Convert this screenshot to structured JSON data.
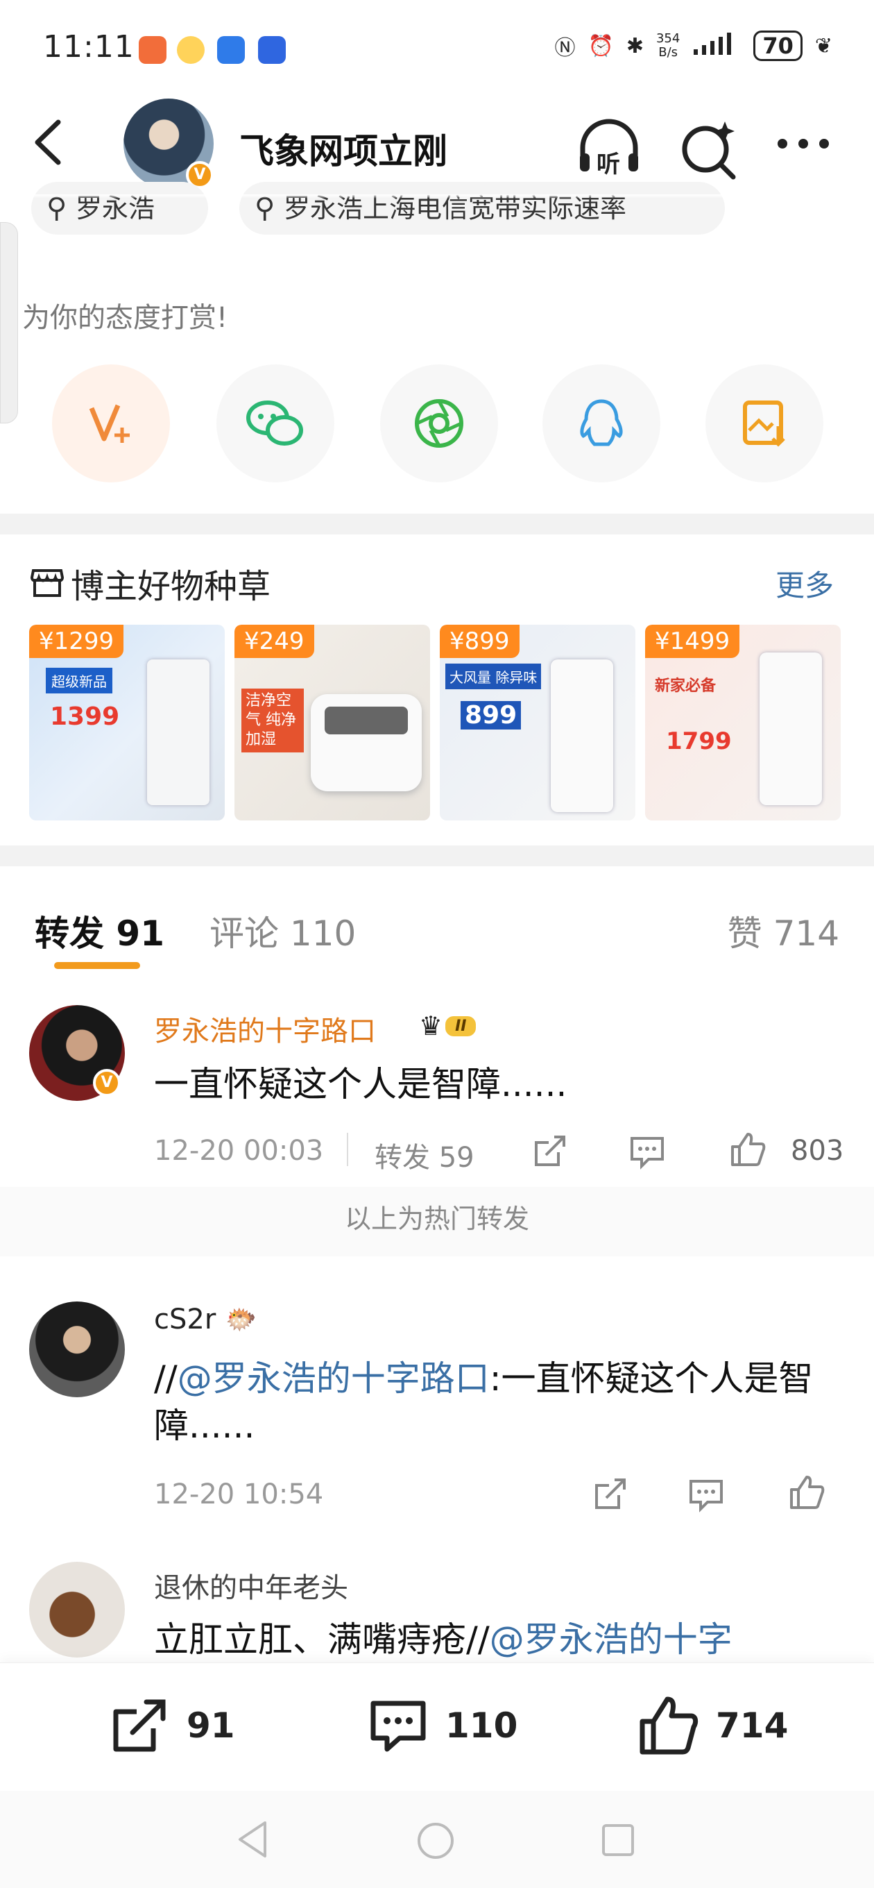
{
  "status_bar": {
    "time": "11:11",
    "net_speed_value": "354",
    "net_speed_unit": "B/s",
    "battery": "70"
  },
  "header": {
    "title": "飞象网项立刚",
    "listen_label": "听"
  },
  "search_chips": [
    "罗永浩",
    "罗永浩上海电信宽带实际速率"
  ],
  "reward": {
    "text": "为你的态度打赏!"
  },
  "share_icons": [
    "vplus-icon",
    "wechat-icon",
    "moments-icon",
    "qq-icon",
    "save-image-icon"
  ],
  "goods": {
    "title": "博主好物种草",
    "more": "更多",
    "products": [
      {
        "price": "¥1299",
        "badge": "超级新品",
        "sub_price": "1399"
      },
      {
        "price": "¥249",
        "badge": "洁净空气 纯净加湿",
        "sub_price": ""
      },
      {
        "price": "¥899",
        "badge": "大风量 除异味",
        "sub_price": "899"
      },
      {
        "price": "¥1499",
        "badge": "新家必备",
        "sub_price": "1799"
      }
    ]
  },
  "tabs": {
    "repost": "转发 91",
    "comment": "评论 110",
    "like": "赞 714"
  },
  "hot_comment": {
    "name": "罗永浩的十字路口",
    "level": "II",
    "text": "一直怀疑这个人是智障......",
    "time": "12-20 00:03",
    "repost": "转发 59",
    "likes": "803"
  },
  "hot_separator": "以上为热门转发",
  "comments": [
    {
      "name": "cS2r",
      "prefix": "//",
      "mention": "@罗永浩的十字路口",
      "text": ":一直怀疑这个人是智障......",
      "time": "12-20 10:54"
    },
    {
      "name": "退休的中年老头",
      "text": "立肛立肛、满嘴痔疮//",
      "mention": "@罗永浩的十字"
    }
  ],
  "bottom_bar": {
    "reposts": "91",
    "comments": "110",
    "likes": "714"
  }
}
